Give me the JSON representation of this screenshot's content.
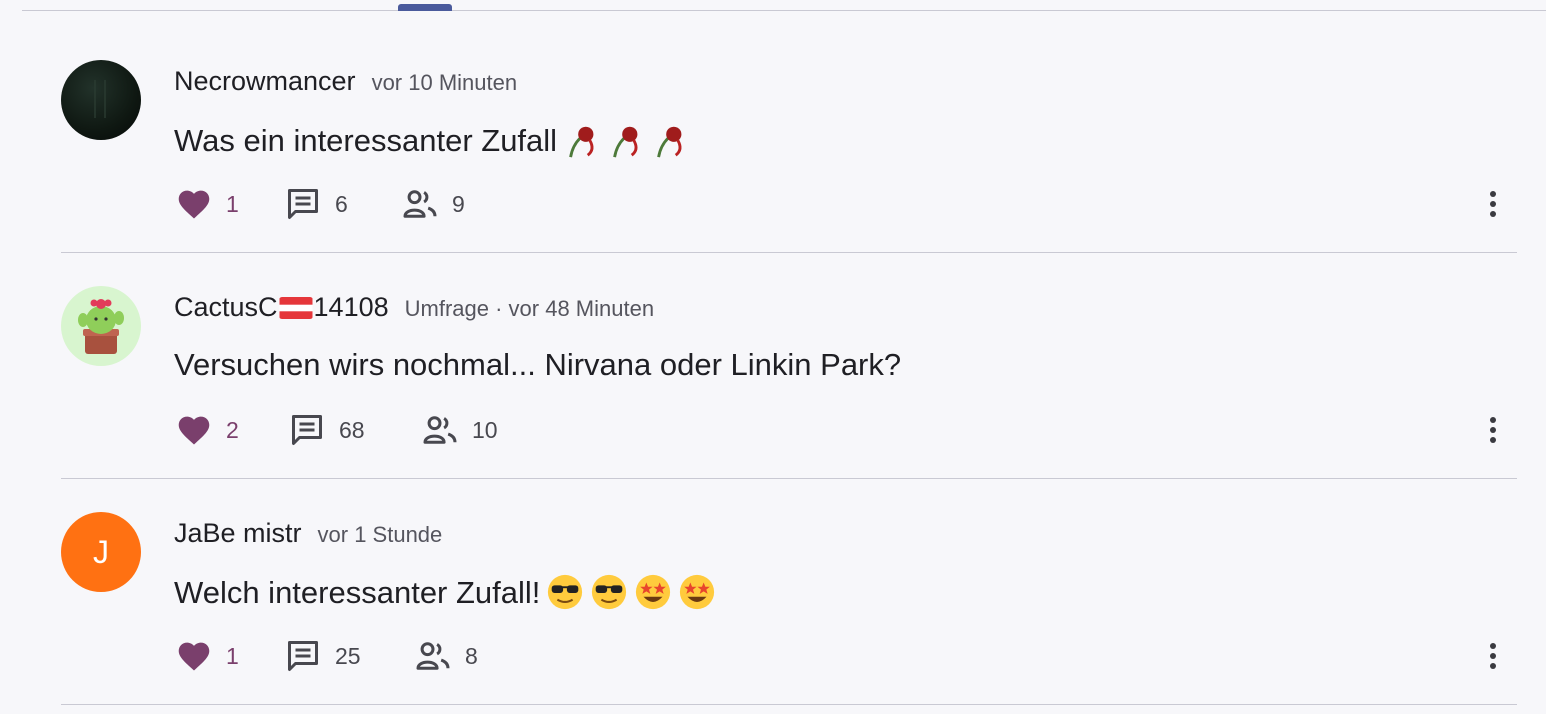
{
  "posts": [
    {
      "author": "Necrowmancer",
      "meta": "vor 10 Minuten",
      "text": "Was ein interessanter Zufall",
      "trailing_emoji": [
        "wilted-rose-icon",
        "wilted-rose-icon",
        "wilted-rose-icon"
      ],
      "likes": "1",
      "comments": "6",
      "participants": "9",
      "avatar": "dark-photo"
    },
    {
      "author_prefix": "CactusC",
      "author_flag": "austria-flag-icon",
      "author_suffix": "14108",
      "meta": "Umfrage · vor 48 Minuten",
      "text": "Versuchen wirs nochmal... Nirvana oder Linkin Park?",
      "likes": "2",
      "comments": "68",
      "participants": "10",
      "avatar": "cactus-illustration"
    },
    {
      "author": "JaBe mistr",
      "meta": "vor 1 Stunde",
      "text": "Welch interessanter Zufall!",
      "trailing_emoji": [
        "sunglasses-face-icon",
        "sunglasses-face-icon",
        "star-struck-face-icon",
        "star-struck-face-icon"
      ],
      "likes": "1",
      "comments": "25",
      "participants": "8",
      "avatar_initial": "J"
    }
  ],
  "colors": {
    "like": "#7a3f6c",
    "avatar_orange": "#ff7112",
    "tab_indicator": "#4a5a9c",
    "divider": "#c9c9d3"
  }
}
